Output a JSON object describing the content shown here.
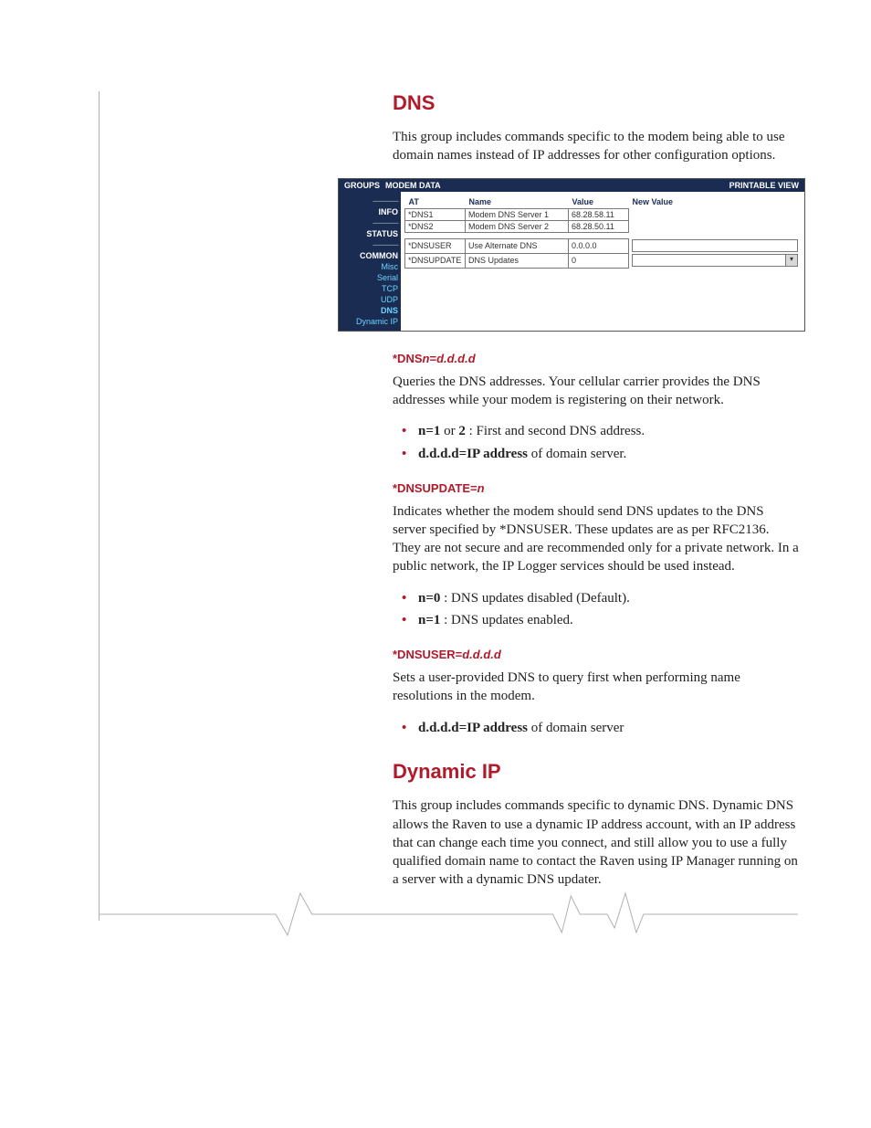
{
  "heading_dns": "DNS",
  "intro_dns": "This group includes commands specific to the modem being able to use domain names instead of IP addresses for other configuration options.",
  "ui": {
    "top_left": "GROUPS",
    "top_center": "MODEM DATA",
    "top_right": "PRINTABLE VIEW",
    "side": {
      "info": "INFO",
      "status": "STATUS",
      "common": "COMMON",
      "misc": "Misc",
      "serial": "Serial",
      "tcp": "TCP",
      "udp": "UDP",
      "dns": "DNS",
      "dyn": "Dynamic IP",
      "sep": "--------------"
    },
    "headers": {
      "at": "AT",
      "name": "Name",
      "value": "Value",
      "new": "New Value"
    },
    "rows": [
      {
        "at": "*DNS1",
        "name": "Modem DNS Server 1",
        "value": "68.28.58.11"
      },
      {
        "at": "*DNS2",
        "name": "Modem DNS Server 2",
        "value": "68.28.50.11"
      }
    ],
    "row_user": {
      "at": "*DNSUSER",
      "name": "Use Alternate DNS",
      "value": "0.0.0.0"
    },
    "row_upd": {
      "at": "*DNSUPDATE",
      "name": "DNS Updates",
      "value": "0"
    }
  },
  "cmd1_a": "*DNS",
  "cmd1_b": "n",
  "cmd1_c": "=",
  "cmd1_d": "d.d.d.d",
  "cmd1_desc": "Queries the DNS addresses. Your cellular carrier provides the DNS addresses while your modem is registering on their network.",
  "cmd1_b1a": "n=1",
  "cmd1_b1b": " or ",
  "cmd1_b1c": "2",
  "cmd1_b1d": " : First and second DNS address.",
  "cmd1_b2a": "d.d.d.d=IP address",
  "cmd1_b2b": " of domain server.",
  "cmd2_a": "*DNSUPDATE=",
  "cmd2_b": "n",
  "cmd2_desc": "Indicates whether the modem should send DNS updates to the DNS server specified by *DNSUSER. These updates are as per RFC2136. They are not secure and are recommended only for a private network. In a public network, the IP Logger services should be used instead.",
  "cmd2_b1a": "n=0",
  "cmd2_b1b": " : DNS updates disabled (Default).",
  "cmd2_b2a": "n=1",
  "cmd2_b2b": " : DNS updates enabled.",
  "cmd3_a": "*DNSUSER=",
  "cmd3_b": "d.d.d.d",
  "cmd3_desc": "Sets a user-provided DNS to query first when performing name resolutions in the modem.",
  "cmd3_b1a": "d.d.d.d=IP address",
  "cmd3_b1b": " of domain server",
  "heading_dyn": "Dynamic IP",
  "intro_dyn": "This group includes commands specific to dynamic DNS. Dynamic DNS allows the Raven to use a dynamic IP address account, with an IP address that can change each time you connect, and still allow you to use a fully qualified domain name to contact the Raven using IP Manager running on a server with a dynamic DNS updater."
}
